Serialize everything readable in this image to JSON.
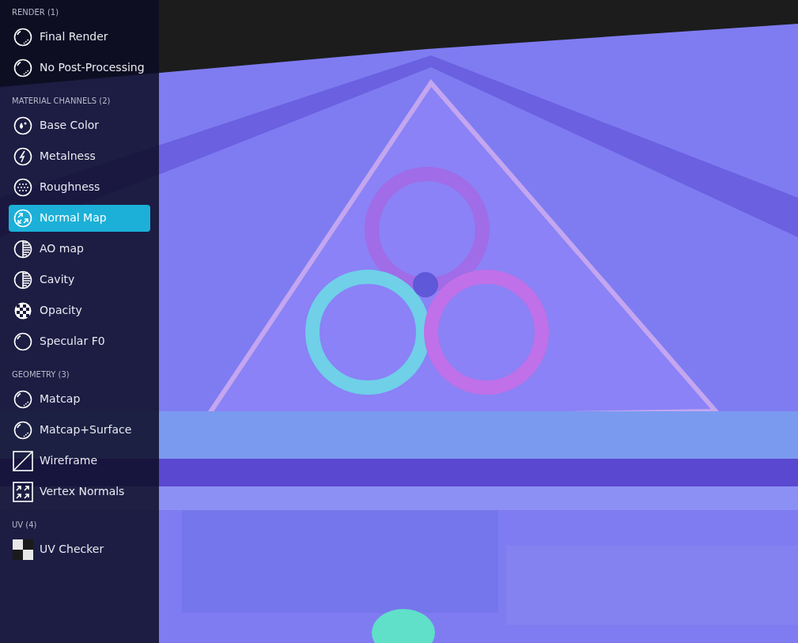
{
  "sidebar": {
    "sections": [
      {
        "title": "RENDER (1)",
        "items": [
          {
            "label": "Final Render",
            "kind": "sphere",
            "selected": false
          },
          {
            "label": "No Post-Processing",
            "kind": "sphere",
            "selected": false
          }
        ]
      },
      {
        "title": "MATERIAL CHANNELS (2)",
        "items": [
          {
            "label": "Base Color",
            "kind": "drop",
            "selected": false
          },
          {
            "label": "Metalness",
            "kind": "bolt",
            "selected": false
          },
          {
            "label": "Roughness",
            "kind": "dots",
            "selected": false
          },
          {
            "label": "Normal Map",
            "kind": "arrows",
            "selected": true
          },
          {
            "label": "AO map",
            "kind": "half",
            "selected": false
          },
          {
            "label": "Cavity",
            "kind": "half",
            "selected": false
          },
          {
            "label": "Opacity",
            "kind": "checker",
            "selected": false
          },
          {
            "label": "Specular F0",
            "kind": "gloss",
            "selected": false
          }
        ]
      },
      {
        "title": "GEOMETRY (3)",
        "items": [
          {
            "label": "Matcap",
            "kind": "sphere",
            "selected": false
          },
          {
            "label": "Matcap+Surface",
            "kind": "sphere",
            "selected": false
          },
          {
            "label": "Wireframe",
            "kind": "diagonal",
            "selected": false
          },
          {
            "label": "Vertex Normals",
            "kind": "vertex",
            "selected": false
          }
        ]
      },
      {
        "title": "UV (4)",
        "items": [
          {
            "label": "UV Checker",
            "kind": "uv",
            "selected": false
          }
        ]
      }
    ]
  }
}
